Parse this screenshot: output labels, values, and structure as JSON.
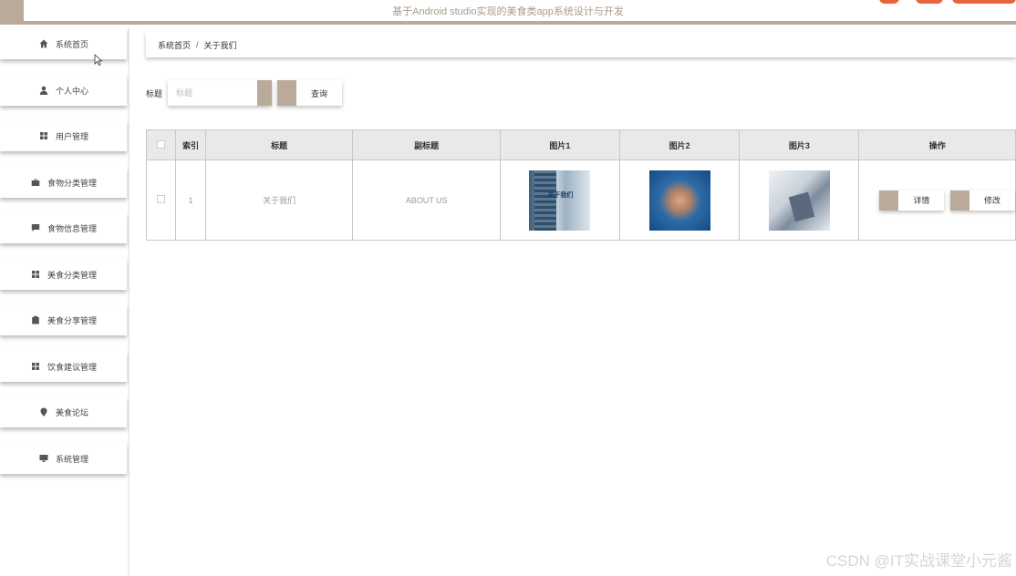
{
  "header": {
    "title": "基于Android studio实现的美食类app系统设计与开发"
  },
  "sidebar": {
    "items": [
      {
        "label": "系统首页",
        "icon": "home-icon"
      },
      {
        "label": "个人中心",
        "icon": "user-icon"
      },
      {
        "label": "用户管理",
        "icon": "grid-icon"
      },
      {
        "label": "食物分类管理",
        "icon": "briefcase-icon"
      },
      {
        "label": "食物信息管理",
        "icon": "message-icon"
      },
      {
        "label": "美食分类管理",
        "icon": "grid-icon"
      },
      {
        "label": "美食分享管理",
        "icon": "clipboard-icon"
      },
      {
        "label": "饮食建议管理",
        "icon": "grid-icon"
      },
      {
        "label": "美食论坛",
        "icon": "location-pin-icon"
      },
      {
        "label": "系统管理",
        "icon": "monitor-icon"
      }
    ]
  },
  "breadcrumb": {
    "home": "系统首页",
    "separator": "/",
    "current": "关于我们"
  },
  "search": {
    "label": "标题",
    "placeholder": "标题",
    "button": "查询"
  },
  "table": {
    "headers": [
      "索引",
      "标题",
      "副标题",
      "图片1",
      "图片2",
      "图片3",
      "操作"
    ],
    "rows": [
      {
        "index": "1",
        "title": "关于我们",
        "subtitle": "ABOUT US",
        "image1_text": "关于我们",
        "detail_button": "详情",
        "edit_button": "修改"
      }
    ]
  },
  "watermark": "CSDN @IT实战课堂小元酱",
  "colors": {
    "accent": "#b9aa99",
    "header_bg": "#e9e9e9"
  }
}
